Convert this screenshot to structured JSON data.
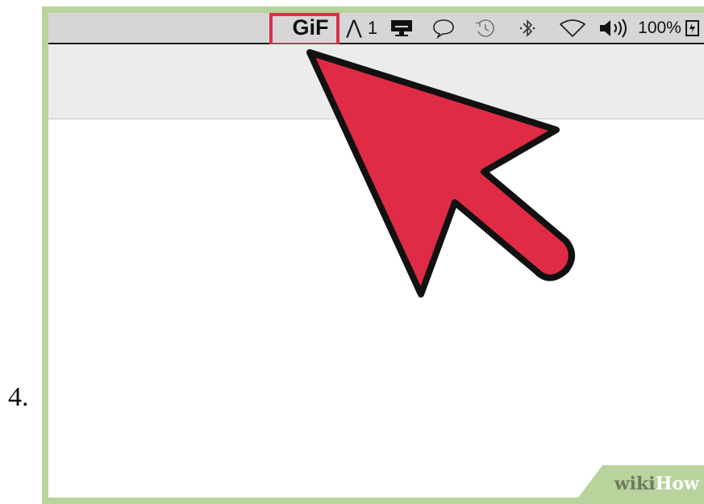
{
  "step": {
    "number": "4."
  },
  "menubar": {
    "gif_label": "GiF",
    "adobe_glyph": "⋀",
    "adobe_count": "1",
    "battery_label": "100%",
    "icons": [
      "gif-brewery-icon",
      "adobe-icon",
      "display-icon",
      "chat-icon",
      "time-machine-icon",
      "bluetooth-icon",
      "wifi-icon",
      "volume-icon",
      "battery-icon"
    ]
  },
  "watermark": {
    "wiki": "wiki",
    "how": "How"
  },
  "colors": {
    "accent": "#d8324a",
    "frame": "#b9d39c",
    "menubar": "#d6d6d6"
  }
}
